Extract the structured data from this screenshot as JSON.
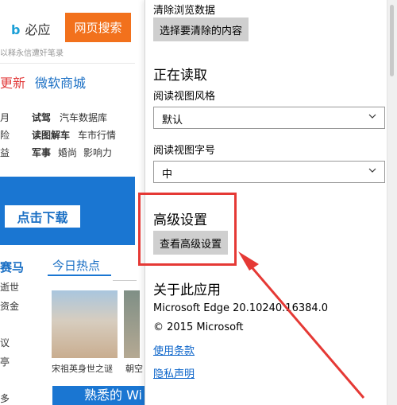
{
  "left_page": {
    "brand": "必应",
    "search_button": "网页搜索",
    "hint": "以释永信遭奸笔录",
    "nav_update": "更新",
    "nav_store": "微软商城",
    "rows": [
      {
        "c0": "月",
        "c1": "试驾",
        "c2": "汽车数据库"
      },
      {
        "c0": "险",
        "c1": "读图解车",
        "c2": "车市行情"
      },
      {
        "c0": "益",
        "c1": "军事",
        "c2": "婚尚",
        "c3": "影响力"
      }
    ],
    "download_button": "点击下载",
    "section_left": "赛马",
    "tab_today": "今日热点",
    "side_chars": [
      "逝世",
      "资金",
      "议",
      "亭",
      "多"
    ],
    "caption1": "宋祖英身世之谜",
    "caption2": "朝空",
    "bottom_banner": "熟悉的 Wi"
  },
  "panel": {
    "clear_data_title": "清除浏览数据",
    "choose_clear_button": "选择要清除的内容",
    "reading_heading": "正在读取",
    "reading_style_label": "阅读视图风格",
    "reading_style_value": "默认",
    "reading_font_label": "阅读视图字号",
    "reading_font_value": "中",
    "advanced_heading": "高级设置",
    "view_advanced_button": "查看高级设置",
    "about_heading": "关于此应用",
    "version": "Microsoft Edge 20.10240.16384.0",
    "copyright": "© 2015 Microsoft",
    "terms_link": "使用条款",
    "privacy_link": "隐私声明"
  },
  "colors": {
    "accent_orange": "#f2711c",
    "accent_blue": "#1a76d2",
    "highlight_red": "#e53935",
    "link_blue": "#0a63c9"
  }
}
